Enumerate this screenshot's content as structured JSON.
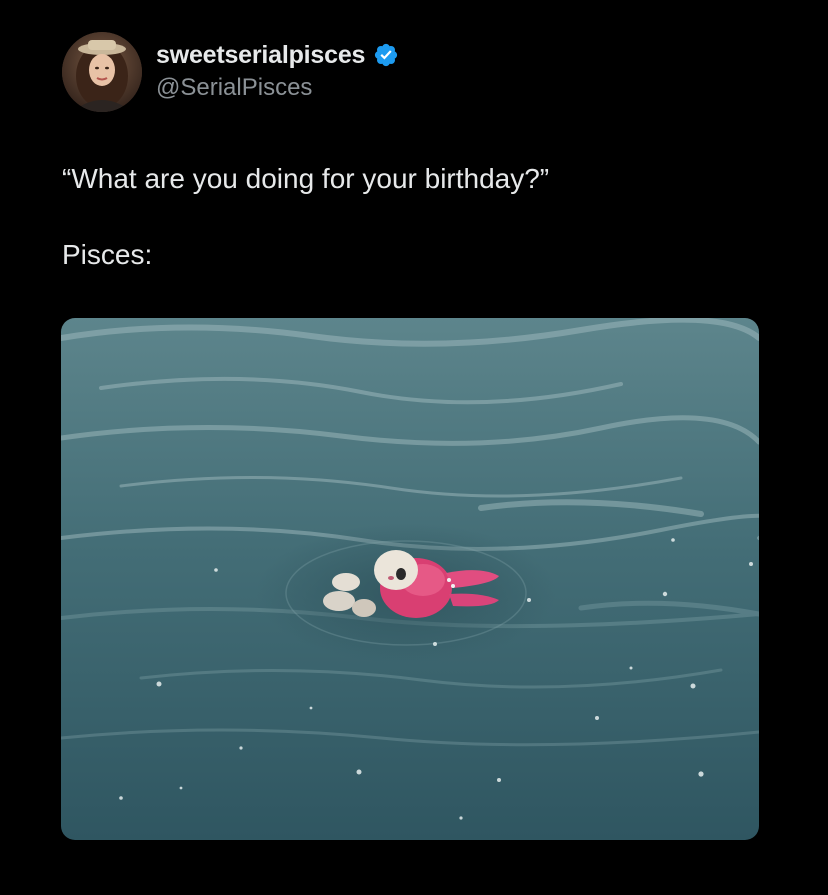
{
  "tweet": {
    "author": {
      "display_name": "sweetserialpisces",
      "handle": "@SerialPisces",
      "verified": true,
      "verified_color": "#1d9bf0",
      "avatar_icon": "profile-photo"
    },
    "text_lines": [
      "“What are you doing for your birthday?”",
      "Pisces:"
    ],
    "media": {
      "type": "photo",
      "icon": "photo-plush-toy-floating-in-water"
    }
  },
  "colors": {
    "background": "#000000",
    "primary_text": "#e7e9ea",
    "secondary_text": "#8b9196",
    "water": "#3f6a73",
    "plush_pink": "#e0467a"
  }
}
